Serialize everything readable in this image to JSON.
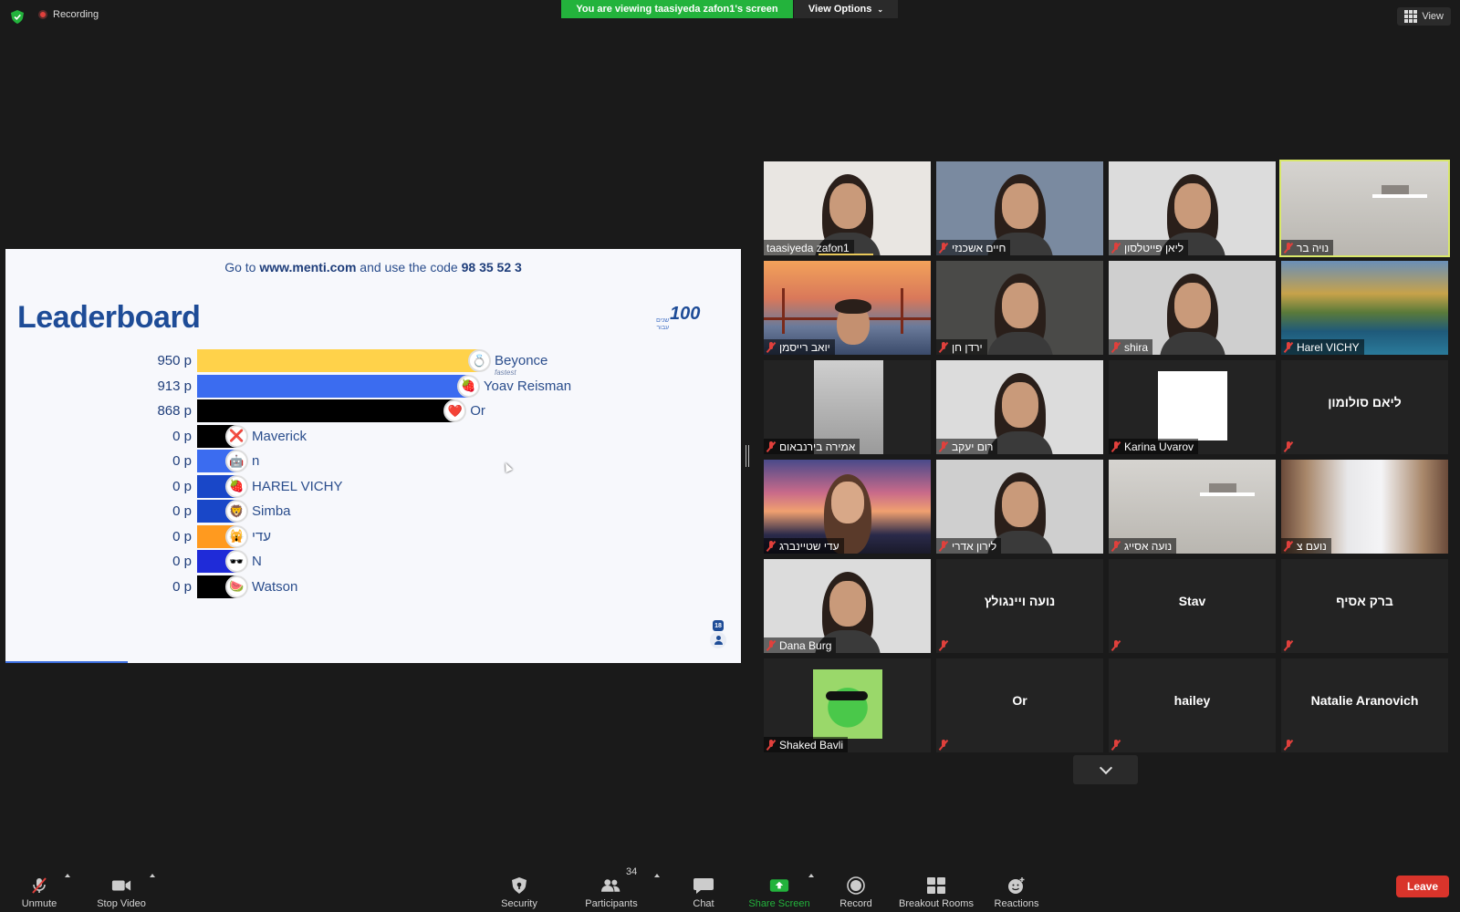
{
  "top": {
    "recording_label": "Recording",
    "viewing_banner": "You are viewing taasiyeda zafon1's screen",
    "view_options": "View Options",
    "view_label": "View"
  },
  "screen": {
    "code_prefix": "Go to",
    "code_site": "www.menti.com",
    "code_mid": "and use the code",
    "code_value": "98 35 52 3",
    "title": "Leaderboard",
    "logo": "100",
    "logo_small": "שנים\nעבור",
    "participants_count": "18",
    "fastest_label": "fastest",
    "leaderboard": [
      {
        "score": "950 p",
        "name": "Beyonce",
        "color": "#ffd24a",
        "emoji": "💍"
      },
      {
        "score": "913 p",
        "name": "Yoav Reisman",
        "color": "#3b6cf0",
        "emoji": "🍓"
      },
      {
        "score": "868 p",
        "name": "Or",
        "color": "#000000",
        "emoji": "❤️"
      },
      {
        "score": "0 p",
        "name": "Maverick",
        "color": "#000000",
        "emoji": "❌"
      },
      {
        "score": "0 p",
        "name": "n",
        "color": "#3b6cf0",
        "emoji": "🤖"
      },
      {
        "score": "0 p",
        "name": "HAREL VICHY",
        "color": "#1947c8",
        "emoji": "🍓"
      },
      {
        "score": "0 p",
        "name": "Simba",
        "color": "#1947c8",
        "emoji": "🦁"
      },
      {
        "score": "0 p",
        "name": "עדי",
        "color": "#ff9a1f",
        "emoji": "🙀"
      },
      {
        "score": "0 p",
        "name": "N",
        "color": "#1f2bd8",
        "emoji": "🕶️"
      },
      {
        "score": "0 p",
        "name": "Watson",
        "color": "#000000",
        "emoji": "🍉"
      }
    ]
  },
  "gallery": [
    {
      "name": "taasiyeda zafon1",
      "video": "face",
      "active_speaker": true
    },
    {
      "name": "חיים אשכנזי",
      "video": "face"
    },
    {
      "name": "ליאן פייטלסון",
      "video": "face"
    },
    {
      "name": "נויה בר",
      "video": "room",
      "highlighted": true
    },
    {
      "name": "יואב רייסמן",
      "video": "bridge"
    },
    {
      "name": "ירדן חן",
      "video": "face"
    },
    {
      "name": "shira",
      "video": "face"
    },
    {
      "name": "Harel VICHY",
      "video": "lake"
    },
    {
      "name": "אמירה בירנבאום",
      "video": "blank"
    },
    {
      "name": "רום יעקב",
      "video": "face"
    },
    {
      "name": "Karina Uvarov",
      "video": "white"
    },
    {
      "name": "ליאם סולומון",
      "video": "none"
    },
    {
      "name": "עדי שטיינברג",
      "video": "sunset"
    },
    {
      "name": "לירון אדרי",
      "video": "face"
    },
    {
      "name": "נועה אסייג",
      "video": "room"
    },
    {
      "name": "נועם צ",
      "video": "curtain"
    },
    {
      "name": "Dana Burg",
      "video": "face"
    },
    {
      "name": "נועה ויינגולץ",
      "video": "none"
    },
    {
      "name": "Stav",
      "video": "none"
    },
    {
      "name": "ברק אסיף",
      "video": "none"
    },
    {
      "name": "Shaked Bavli",
      "video": "frog"
    },
    {
      "name": "Or",
      "video": "none"
    },
    {
      "name": "hailey",
      "video": "none"
    },
    {
      "name": "Natalie Aranovich",
      "video": "none"
    }
  ],
  "toolbar": {
    "unmute": "Unmute",
    "stop_video": "Stop Video",
    "security": "Security",
    "participants": "Participants",
    "participants_count": "34",
    "chat": "Chat",
    "share_screen": "Share Screen",
    "record": "Record",
    "breakout_rooms": "Breakout Rooms",
    "reactions": "Reactions",
    "leave": "Leave"
  },
  "colors": {
    "share_green": "#23b33c",
    "leave_red": "#d9342b",
    "active_outline": "#d9e86a"
  }
}
